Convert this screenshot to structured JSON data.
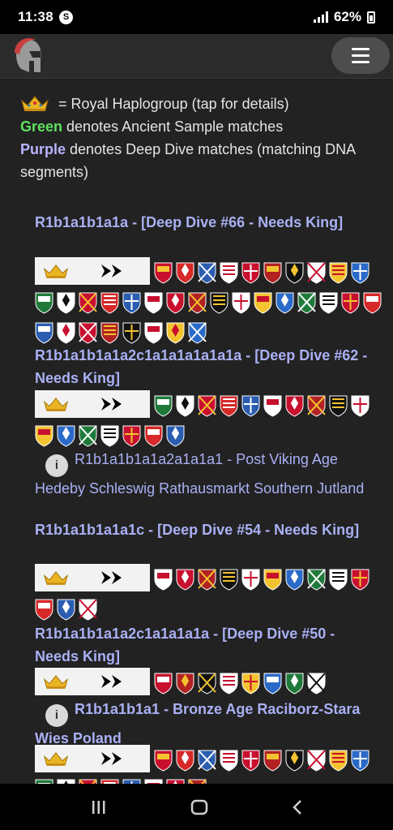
{
  "status": {
    "time": "11:38",
    "badge": "S",
    "battery": "62%"
  },
  "legend": {
    "crown_text": "= Royal Haplogroup (tap for details)",
    "green_word": "Green",
    "green_text": " denotes Ancient Sample matches",
    "purple_word": "Purple",
    "purple_text": " denotes Deep Dive matches (matching DNA segments)"
  },
  "entries": [
    {
      "title": "R1b1a1b1a1a - [Deep Dive #66 - Needs King]"
    },
    {
      "title": "R1b1a1b1a1a2c1a1a1a1a1a1a - [Deep Dive #62 - Needs King]"
    },
    {
      "sub": "R1b1a1b1a1a2a1a1a1 - Post Viking Age Hedeby Schleswig Rathausmarkt Southern Jutland"
    },
    {
      "title": "R1b1a1b1a1a1c - [Deep Dive #54 - Needs King]"
    },
    {
      "title": "R1b1a1b1a1a2c1a1a1a1a - [Deep Dive #50 - Needs King]"
    },
    {
      "title": "R1b1a1b1a1 - Bronze Age Raciborz-Stara Wies Poland"
    }
  ],
  "colors": {
    "accent": "#a9b0f4",
    "green": "#5ee05e",
    "purple": "#b9b3ff",
    "background": "#222222"
  },
  "icons": [
    "crown-icon",
    "double-arrow-icon",
    "info-icon",
    "menu-icon",
    "coat-of-arms-icon"
  ]
}
